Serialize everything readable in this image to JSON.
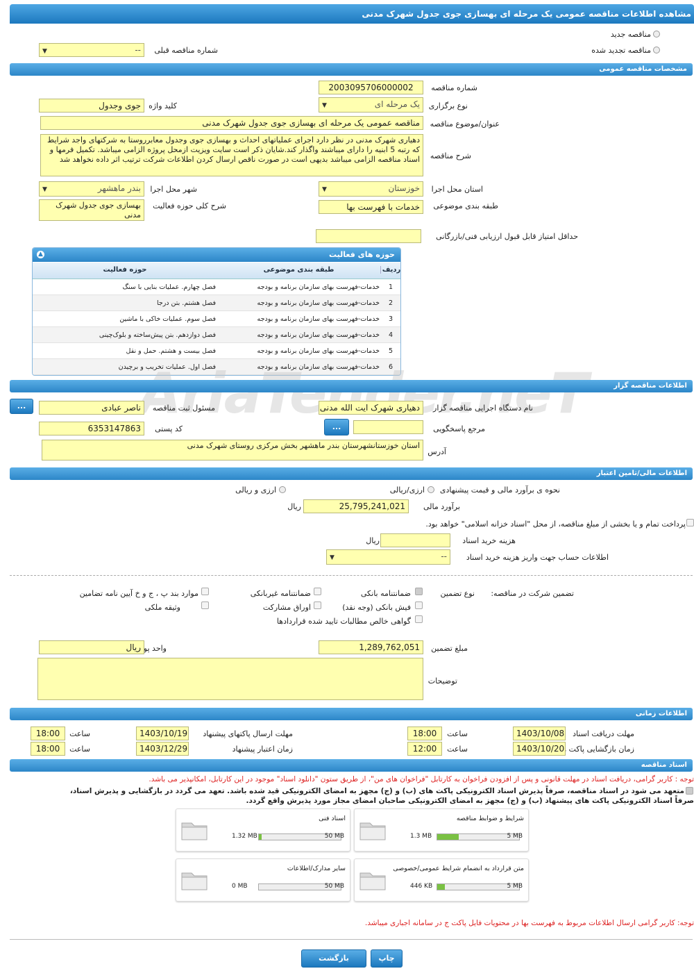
{
  "title": "مشاهده اطلاعات مناقصه عمومی یک مرحله ای بهسازی جوی جدول شهرک مدنی",
  "top": {
    "new_tender": "مناقصه جدید",
    "renewed_tender": "مناقصه تجدید شده",
    "prev_number_label": "شماره مناقصه قبلی",
    "prev_number_value": "--"
  },
  "general": {
    "header": "مشخصات مناقصه عمومی",
    "number_label": "شماره مناقصه",
    "number": "2003095706000002",
    "type_label": "نوع برگزاری",
    "type": "یک مرحله ای",
    "keyword_label": "کلید واژه",
    "keyword": "جوی وجدول",
    "subject_label": "عنوان/موضوع مناقصه",
    "subject": "مناقصه عمومی یک مرحله ای بهسازی جوی جدول شهرک مدنی",
    "desc_label": "شرح مناقصه",
    "desc": "دهیاری شهرک مدنی در نظر دارد اجرای عملیاتهای احداث و بهسازی جوی وجدول معابرروستا به شرکتهای واجد شرایط که رتبه 5 ابنیه را دارای میباشند واگذار کند.شایان ذکر است سایت ویزیت ازمحل پروژه الزامی میباشد. تکمیل فرمها و اسناد مناقصه الزامی میباشد بدیهی است در صورت ناقص ارسال کردن اطلاعات شرکت ترتیب اثر داده نخواهد شد",
    "province_label": "استان محل اجرا",
    "province": "خوزستان",
    "city_label": "شهر محل اجرا",
    "city": "بندر ماهشهر",
    "category_label": "طبقه بندی موضوعی",
    "category": "خدمات با فهرست بها",
    "activity_label": "شرح کلی حوزه فعالیت",
    "activity": "بهسازی جوی جدول شهرک مدنی",
    "min_score_label": "حداقل امتیاز قابل قبول ارزیابی فنی/بازرگانی",
    "min_score": ""
  },
  "activities": {
    "header": "حوزه های فعالیت",
    "col_row": "ردیف",
    "col_category": "طبقه بندی موضوعی",
    "col_field": "حوزه فعالیت",
    "rows": [
      {
        "n": "1",
        "cat": "خدمات-فهرست بهای سازمان برنامه و بودجه",
        "field": "فصل چهارم. عملیات بنایی با سنگ"
      },
      {
        "n": "2",
        "cat": "خدمات-فهرست بهای سازمان برنامه و بودجه",
        "field": "فصل هشتم. بتن درجا"
      },
      {
        "n": "3",
        "cat": "خدمات-فهرست بهای سازمان برنامه و بودجه",
        "field": "فصل سوم. عملیات خاکی با ماشین"
      },
      {
        "n": "4",
        "cat": "خدمات-فهرست بهای سازمان برنامه و بودجه",
        "field": "فصل دوازدهم. بتن پیش‌ساخته و بلوک‌چینی"
      },
      {
        "n": "5",
        "cat": "خدمات-فهرست بهای سازمان برنامه و بودجه",
        "field": "فصل بیست و هشتم. حمل و نقل"
      },
      {
        "n": "6",
        "cat": "خدمات-فهرست بهای سازمان برنامه و بودجه",
        "field": "فصل اول. عملیات تخریب و برچیدن"
      }
    ]
  },
  "organizer": {
    "header": "اطلاعات مناقصه گزار",
    "org_label": "نام دستگاه اجرایی مناقصه گزار",
    "org": "دهیاری شهرک ایت الله مدنی",
    "officer_label": "مسئول ثبت مناقصه",
    "officer": "ناصر عبادی",
    "ref_label": "مرجع پاسخگویی",
    "ref": "",
    "postal_label": "کد پستی",
    "postal": "6353147863",
    "address_label": "آدرس",
    "address": "استان خوزستانشهرستان بندر ماهشهر بخش مرکزی روستای شهرک مدنی",
    "dots": "..."
  },
  "finance": {
    "header": "اطلاعات مالی/تامین اعتبار",
    "method_label": "نحوه ی برآورد مالی و قیمت پیشنهادی",
    "opt1": "ارزی/ریالی",
    "opt2": "ارزی و ریالی",
    "estimate_label": "برآورد مالی",
    "estimate": "25,795,241,021",
    "unit_rial": "ریال",
    "treasury": "پرداخت تمام و یا بخشی از مبلغ مناقصه، از محل \"اسناد خزانه اسلامی\" خواهد بود.",
    "doc_cost_label": "هزینه خرید اسناد",
    "doc_cost": "",
    "account_label": "اطلاعات حساب جهت واریز هزینه خرید اسناد",
    "account": "--"
  },
  "guarantee": {
    "label": "تضمین شرکت در مناقصه:",
    "type_label": "نوع تضمین",
    "bank": "ضمانتنامه بانکی",
    "nonbank": "ضمانتنامه غیربانکی",
    "clauses": "موارد بند پ ، ج و خ آیین نامه تضامین",
    "cash": "فیش بانکی (وجه نقد)",
    "bonds": "اوراق مشارکت",
    "property": "وثیقه ملکی",
    "receivables": "گواهی خالص مطالبات تایید شده قراردادها",
    "amount_label": "مبلغ تضمین",
    "amount": "1,289,762,051",
    "currency_label": "واحد پول",
    "currency": "ریال",
    "notes_label": "توضیحات",
    "notes": ""
  },
  "times": {
    "header": "اطلاعات زمانی",
    "doc_deadline_label": "مهلت دریافت اسناد",
    "doc_deadline": "1403/10/08",
    "doc_time": "18:00",
    "send_deadline_label": "مهلت ارسال پاکتهای پیشنهاد",
    "send_deadline": "1403/10/19",
    "send_time": "18:00",
    "open_label": "زمان بازگشایی پاکت ها",
    "open_date": "1403/10/20",
    "open_time": "12:00",
    "valid_label": "زمان اعتبار پیشنهاد",
    "valid_date": "1403/12/29",
    "valid_time": "18:00",
    "time_label": "ساعت"
  },
  "docs": {
    "header": "اسناد مناقصه",
    "note1": "توجه : کاربر گرامی، دریافت اسناد در مهلت قانونی و پس از افزودن فراخوان به کارتابل \"فراخوان های من\"، از طریق ستون \"دانلود اسناد\" موجود در این کارتابل، امکانپذیر می باشد.",
    "commit1": "متعهد می شود در اسناد مناقصه، صرفاً پذیرش اسناد الکترونیکی پاکت های (ب) و (ج) مجهز به امضای الکترونیکی قید شده باشد. تعهد می گردد در بازگشایی و پذیرش اسناد،",
    "commit2": "صرفاً اسناد الکترونیکی پاکت های پیشنهاد (ب) و (ج) مجهز به امضای الکترونیکی صاحبان امضای مجاز مورد پذیرش واقع گردد.",
    "files": [
      {
        "name": "شرایط و ضوابط مناقصه",
        "size": "1.3 MB",
        "max": "5 MB",
        "pct": 0.26
      },
      {
        "name": "اسناد فنی",
        "size": "1.32 MB",
        "max": "50 MB",
        "pct": 0.03
      },
      {
        "name": "متن قرارداد به انضمام شرایط عمومی/خصوصی",
        "size": "446 KB",
        "max": "5 MB",
        "pct": 0.09
      },
      {
        "name": "سایر مدارک/اطلاعات",
        "size": "0 MB",
        "max": "50 MB",
        "pct": 0
      }
    ],
    "note2": "توجه: کاربر گرامی ارسال اطلاعات مربوط به فهرست بها در محتویات فایل پاکت ج در سامانه اجباری میباشد."
  },
  "buttons": {
    "print": "چاپ",
    "back": "بازگشت"
  },
  "watermark": "AriaTender.neT"
}
